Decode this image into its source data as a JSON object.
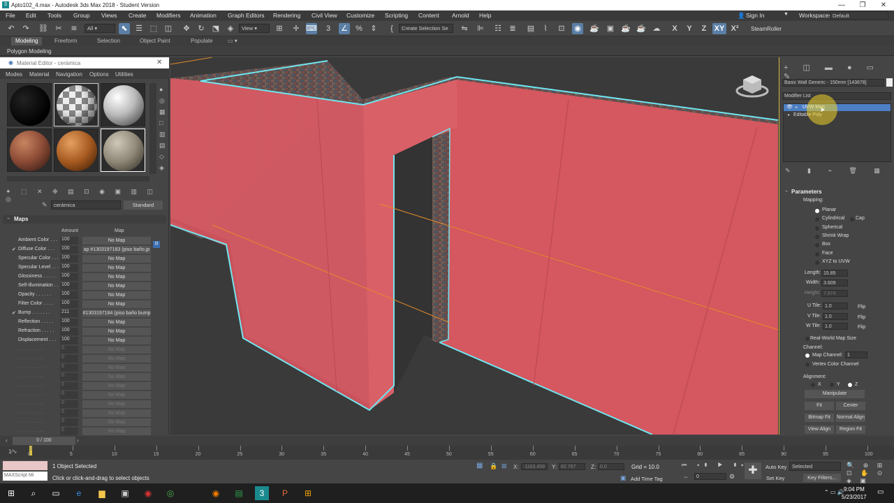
{
  "window": {
    "title": "Apto102_4.max - Autodesk 3ds Max 2018 - Student Version",
    "min": "—",
    "max": "❐",
    "close": "✕"
  },
  "menu": [
    "File",
    "Edit",
    "Tools",
    "Group",
    "Views",
    "Create",
    "Modifiers",
    "Animation",
    "Graph Editors",
    "Rendering",
    "Civil View",
    "Customize",
    "Scripting",
    "Content",
    "Arnold",
    "Help"
  ],
  "signin": {
    "label": "Sign In",
    "workspaces_label": "Workspaces:",
    "workspace": "Default"
  },
  "toolbar": {
    "selection_filter": "All",
    "ref_coord": "View",
    "named_sel": "Create Selection Se",
    "steamroller": "SteamRoller",
    "axes": [
      "X",
      "Y",
      "Z",
      "XY",
      "X²"
    ]
  },
  "ribbon": {
    "tabs": [
      "Modeling",
      "Freeform",
      "Selection",
      "Object Paint",
      "Populate"
    ],
    "sub": "Polygon Modeling"
  },
  "material_editor": {
    "title": "Material Editor - cerámica",
    "menu": [
      "Modes",
      "Material",
      "Navigation",
      "Options",
      "Utilities"
    ],
    "material_name": "cerámica",
    "material_type": "Standard",
    "maps_title": "Maps",
    "col_amount": "Amount",
    "col_map": "Map",
    "maps": [
      {
        "label": "Ambient Color . . .",
        "amount": "100",
        "map": "No Map",
        "checked": false,
        "dim": false
      },
      {
        "label": "Diffuse Color . . .",
        "amount": "100",
        "map": "ap #1303197183 (piso baño.jp",
        "checked": true,
        "dim": false
      },
      {
        "label": "Specular Color . . .",
        "amount": "100",
        "map": "No Map",
        "checked": false,
        "dim": false
      },
      {
        "label": "Specular Level . . .",
        "amount": "100",
        "map": "No Map",
        "checked": false,
        "dim": false
      },
      {
        "label": "Glossiness . . . . .",
        "amount": "100",
        "map": "No Map",
        "checked": false,
        "dim": false
      },
      {
        "label": "Self-Illumination . .",
        "amount": "100",
        "map": "No Map",
        "checked": false,
        "dim": false
      },
      {
        "label": "Opacity . . . . . .",
        "amount": "100",
        "map": "No Map",
        "checked": false,
        "dim": false
      },
      {
        "label": "Filter Color . . . .",
        "amount": "100",
        "map": "No Map",
        "checked": false,
        "dim": false
      },
      {
        "label": "Bump . . . . . . .",
        "amount": "211",
        "map": "#1303197184 (piso baño bump",
        "checked": true,
        "dim": false
      },
      {
        "label": "Reflection . . . . .",
        "amount": "100",
        "map": "No Map",
        "checked": false,
        "dim": false
      },
      {
        "label": "Refraction . . . . .",
        "amount": "100",
        "map": "No Map",
        "checked": false,
        "dim": false
      },
      {
        "label": "Displacement . . .",
        "amount": "100",
        "map": "No Map",
        "checked": false,
        "dim": false
      },
      {
        "label": ". . . . . . . . . .",
        "amount": "0",
        "map": "No Map",
        "checked": false,
        "dim": true
      },
      {
        "label": ". . . . . . . . . .",
        "amount": "0",
        "map": "No Map",
        "checked": false,
        "dim": true
      },
      {
        "label": ". . . . . . . . . .",
        "amount": "0",
        "map": "No Map",
        "checked": false,
        "dim": true
      },
      {
        "label": ". . . . . . . . . .",
        "amount": "0",
        "map": "No Map",
        "checked": false,
        "dim": true
      },
      {
        "label": ". . . . . . . . . .",
        "amount": "0",
        "map": "No Map",
        "checked": false,
        "dim": true
      },
      {
        "label": ". . . . . . . . . .",
        "amount": "0",
        "map": "No Map",
        "checked": false,
        "dim": true
      },
      {
        "label": ". . . . . . . . . .",
        "amount": "0",
        "map": "No Map",
        "checked": false,
        "dim": true
      },
      {
        "label": ". . . . . . . . . .",
        "amount": "0",
        "map": "No Map",
        "checked": false,
        "dim": true
      },
      {
        "label": ". . . . . . . . . .",
        "amount": "0",
        "map": "No Map",
        "checked": false,
        "dim": true
      },
      {
        "label": ". . . . . . . . . .",
        "amount": "0",
        "map": "No Map",
        "checked": false,
        "dim": true
      }
    ]
  },
  "command_panel": {
    "object_name": "Basic Wall Generic - 150mm [143678]",
    "modifier_list": "Modifier List",
    "stack": [
      "UVW Map",
      "Editable Poly"
    ],
    "params_title": "Parameters",
    "mapping_label": "Mapping:",
    "mapping_options": [
      "Planar",
      "Cylindrical",
      "Spherical",
      "Shrink Wrap",
      "Box",
      "Face",
      "XYZ to UVW"
    ],
    "cap_label": "Cap",
    "length_label": "Length:",
    "length": "15.85",
    "width_label": "Width:",
    "width": "3.609",
    "height_label": "Height:",
    "height": "7.874",
    "utile_label": "U Tile:",
    "utile": "1.0",
    "vtile_label": "V Tile:",
    "vtile": "1.0",
    "wtile_label": "W Tile:",
    "wtile": "1.0",
    "flip_label": "Flip",
    "realworld": "Real-World Map Size",
    "channel_label": "Channel:",
    "map_channel_label": "Map Channel:",
    "map_channel": "1",
    "vertex_color": "Vertex Color Channel",
    "alignment_label": "Alignment:",
    "axes": [
      "X",
      "Y",
      "Z"
    ],
    "buttons": [
      "Manipulate",
      "Fit",
      "Center",
      "Bitmap Fit",
      "Normal Align",
      "View Align",
      "Region Fit"
    ]
  },
  "timeline": {
    "slider": "0 / 100",
    "ticks": [
      "0",
      "5",
      "10",
      "15",
      "20",
      "25",
      "30",
      "35",
      "40",
      "45",
      "50",
      "55",
      "60",
      "65",
      "70",
      "75",
      "80",
      "85",
      "90",
      "95",
      "100"
    ]
  },
  "status": {
    "script_label": "MAXScript Mi",
    "selected": "1 Object Selected",
    "hint": "Click or click-and-drag to select objects",
    "x_label": "X:",
    "x": "-1163.459",
    "y_label": "Y:",
    "y": "82.767",
    "z_label": "Z:",
    "z": "0.0",
    "grid": "Grid = 10.0",
    "add_time_tag": "Add Time Tag",
    "auto_key": "Auto Key",
    "selected_dd": "Selected",
    "set_key": "Set Key",
    "key_filters": "Key Filters...",
    "frame": "0"
  },
  "taskbar": {
    "time": "9:04 PM",
    "date": "5/23/2017"
  }
}
